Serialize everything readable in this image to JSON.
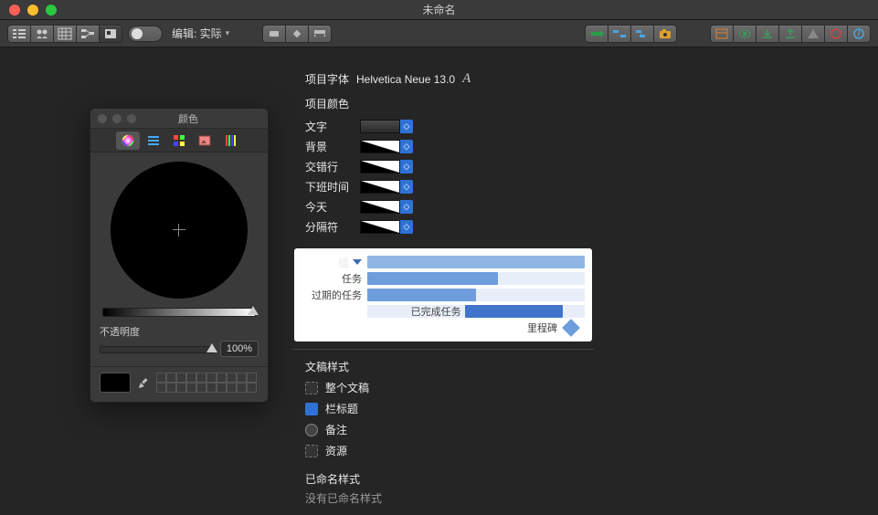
{
  "window": {
    "title": "未命名"
  },
  "toolbar": {
    "edit_label": "编辑: 实际"
  },
  "font": {
    "label": "项目字体",
    "value": "Helvetica Neue 13.0"
  },
  "colors": {
    "section_label": "项目颜色",
    "rows": [
      {
        "label": "文字",
        "diag": false
      },
      {
        "label": "背景",
        "diag": true
      },
      {
        "label": "交错行",
        "diag": true
      },
      {
        "label": "下班时间",
        "diag": true
      },
      {
        "label": "今天",
        "diag": true
      },
      {
        "label": "分隔符",
        "diag": true
      }
    ]
  },
  "gantt": {
    "group": "组",
    "task": "任务",
    "overdue": "过期的任务",
    "done": "已完成任务",
    "milestone": "里程碑"
  },
  "styles": {
    "doc_label": "文稿样式",
    "items": [
      {
        "label": "整个文稿",
        "sel": false,
        "round": false
      },
      {
        "label": "栏标题",
        "sel": true,
        "round": false
      },
      {
        "label": "备注",
        "sel": false,
        "round": true
      },
      {
        "label": "资源",
        "sel": false,
        "round": false
      }
    ],
    "named_label": "已命名样式",
    "none": "没有已命名样式"
  },
  "colorpicker": {
    "title": "颜色",
    "opacity_label": "不透明度",
    "opacity_value": "100%"
  }
}
